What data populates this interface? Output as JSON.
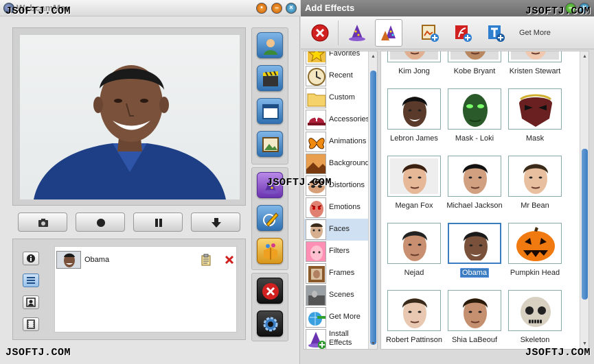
{
  "watermark": "JSOFTJ.COM",
  "left": {
    "title": "WebcamMax",
    "cam_item": {
      "name": "Obama"
    }
  },
  "right": {
    "title": "Add Effects",
    "toolbar": {
      "get_more": "Get More"
    },
    "categories": [
      {
        "label": "Favorites",
        "icon": "star-folder-icon"
      },
      {
        "label": "Recent",
        "icon": "clock-icon"
      },
      {
        "label": "Custom",
        "icon": "folder-icon"
      },
      {
        "label": "Accessories",
        "icon": "cap-icon"
      },
      {
        "label": "Animations",
        "icon": "butterfly-icon"
      },
      {
        "label": "Background",
        "icon": "landscape-icon"
      },
      {
        "label": "Distortions",
        "icon": "distorted-face-icon"
      },
      {
        "label": "Emotions",
        "icon": "angry-face-icon"
      },
      {
        "label": "Faces",
        "icon": "face-icon",
        "selected": true
      },
      {
        "label": "Filters",
        "icon": "filter-face-icon"
      },
      {
        "label": "Frames",
        "icon": "frame-icon"
      },
      {
        "label": "Scenes",
        "icon": "scene-icon"
      },
      {
        "label": "Get More",
        "icon": "globe-arrow-icon"
      },
      {
        "label": "Install Effects",
        "icon": "wizard-hat-plus-icon"
      }
    ],
    "effects": [
      {
        "label": "Kim Jong",
        "partial": true
      },
      {
        "label": "Kobe Bryant",
        "partial": true
      },
      {
        "label": "Kristen Stewart",
        "partial": true
      },
      {
        "label": "Lebron James"
      },
      {
        "label": "Mask - Loki"
      },
      {
        "label": "Mask"
      },
      {
        "label": "Megan Fox"
      },
      {
        "label": "Michael Jackson"
      },
      {
        "label": "Mr Bean"
      },
      {
        "label": "Nejad"
      },
      {
        "label": "Obama",
        "selected": true
      },
      {
        "label": "Pumpkin Head"
      },
      {
        "label": "Robert Pattinson"
      },
      {
        "label": "Shia LaBeouf"
      },
      {
        "label": "Skeleton"
      }
    ]
  },
  "colors": {
    "accent": "#3b7cc1",
    "close_red": "#d02020"
  }
}
